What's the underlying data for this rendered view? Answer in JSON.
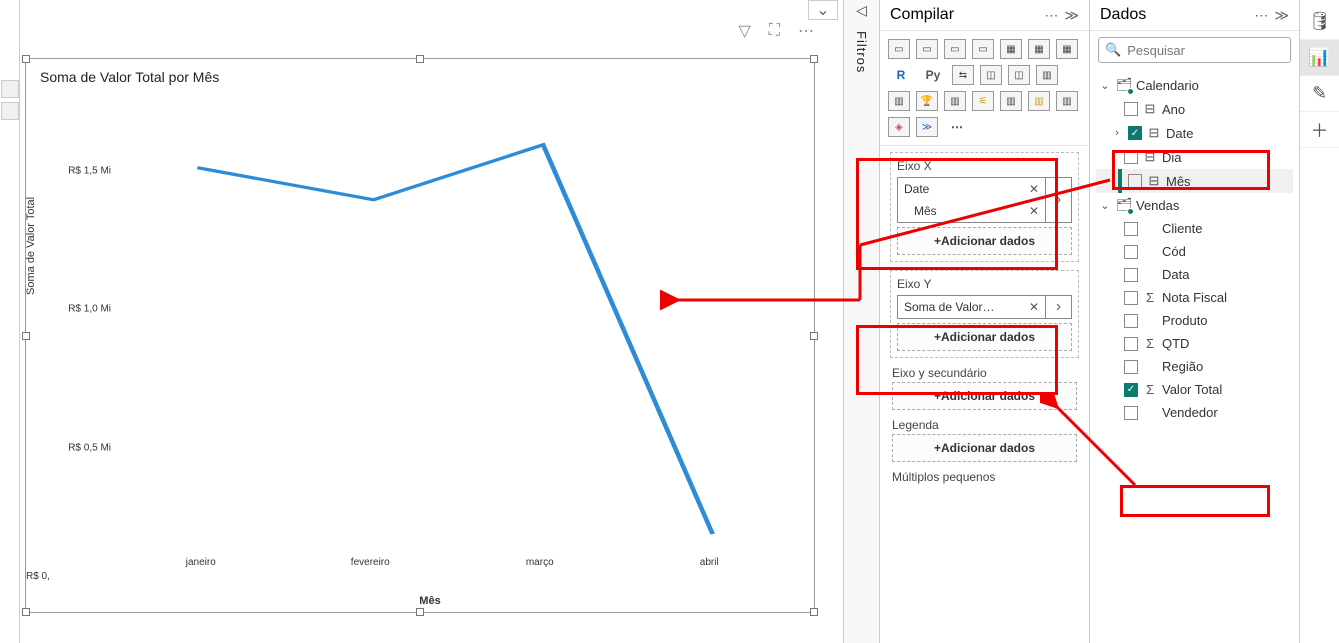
{
  "chart_data": {
    "type": "line",
    "title": "Soma de Valor Total por Mês",
    "xlabel": "Mês",
    "ylabel": "Soma de Valor Total",
    "y_ticks": [
      "R$ 1,5 Mi",
      "R$ 1,0 Mi",
      "R$ 0,5 Mi"
    ],
    "y_truncated_tick": "R$ 0,",
    "categories": [
      "janeiro",
      "fevereiro",
      "março",
      "abril"
    ],
    "values": [
      1600000,
      1480000,
      1700000,
      100000
    ],
    "ylim": [
      0,
      2000000
    ]
  },
  "panes": {
    "filtros": {
      "label": "Filtros"
    },
    "compilar": {
      "title": "Compilar",
      "viz_icons": [
        "R",
        "Py",
        "⇵",
        "⊞",
        "◫",
        "▦",
        "…"
      ],
      "wells": {
        "eixo_x": {
          "label": "Eixo X",
          "fields": [
            {
              "name": "Date",
              "removable": true
            },
            {
              "name": "Mês",
              "removable": true,
              "indent": true
            }
          ],
          "add": "+Adicionar dados"
        },
        "eixo_y": {
          "label": "Eixo Y",
          "fields": [
            {
              "name": "Soma de Valor…",
              "removable": true
            }
          ],
          "add": "+Adicionar dados"
        },
        "eixo_y_sec": {
          "label": "Eixo y secundário",
          "add": "+Adicionar dados"
        },
        "legenda": {
          "label": "Legenda",
          "add": "+Adicionar dados"
        },
        "multiplos": {
          "label": "Múltiplos pequenos"
        }
      }
    },
    "dados": {
      "title": "Dados",
      "search_placeholder": "Pesquisar",
      "tables": [
        {
          "name": "Calendario",
          "expanded": true,
          "fields": [
            {
              "name": "Ano",
              "checked": false,
              "icon": "hier"
            },
            {
              "name": "Date",
              "checked": true,
              "icon": "hier",
              "expandable": true
            },
            {
              "name": "Dia",
              "checked": false,
              "icon": "hier"
            },
            {
              "name": "Mês",
              "checked": false,
              "icon": "hier-alt",
              "hovered": true
            }
          ]
        },
        {
          "name": "Vendas",
          "expanded": true,
          "fields": [
            {
              "name": "Cliente",
              "checked": false
            },
            {
              "name": "Cód",
              "checked": false
            },
            {
              "name": "Data",
              "checked": false
            },
            {
              "name": "Nota Fiscal",
              "checked": false,
              "agg": true
            },
            {
              "name": "Produto",
              "checked": false
            },
            {
              "name": "QTD",
              "checked": false,
              "agg": true
            },
            {
              "name": "Região",
              "checked": false
            },
            {
              "name": "Valor Total",
              "checked": true,
              "agg": true
            },
            {
              "name": "Vendedor",
              "checked": false
            }
          ]
        }
      ]
    }
  },
  "canvas": {
    "chevron": "⌄"
  }
}
